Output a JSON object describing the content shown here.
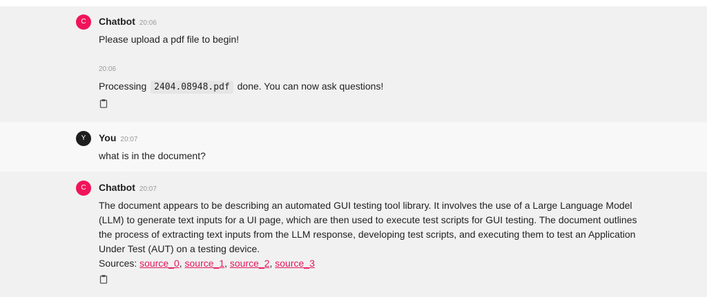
{
  "messages": [
    {
      "author": "Chatbot",
      "avatar_letter": "C",
      "time": "20:06",
      "text": "Please upload a pdf file to begin!"
    },
    {
      "time": "20:06",
      "prefix": "Processing",
      "filename": "2404.08948.pdf",
      "suffix": "done. You can now ask questions!"
    },
    {
      "author": "You",
      "avatar_letter": "Y",
      "time": "20:07",
      "text": "what is in the document?"
    },
    {
      "author": "Chatbot",
      "avatar_letter": "C",
      "time": "20:07",
      "text": "The document appears to be describing an automated GUI testing tool library. It involves the use of a Large Language Model (LLM) to generate text inputs for a UI page, which are then used to execute test scripts for GUI testing. The document outlines the process of extracting text inputs from the LLM response, developing test scripts, and executing them to test an Application Under Test (AUT) on a testing device.",
      "sources_label": "Sources:",
      "sources": [
        "source_0",
        "source_1",
        "source_2",
        "source_3"
      ]
    }
  ],
  "icons": {
    "copy": "clipboard-icon"
  },
  "colors": {
    "accent": "#e4155b",
    "bot_avatar": "#f0145a",
    "user_avatar": "#1e1e1e"
  }
}
